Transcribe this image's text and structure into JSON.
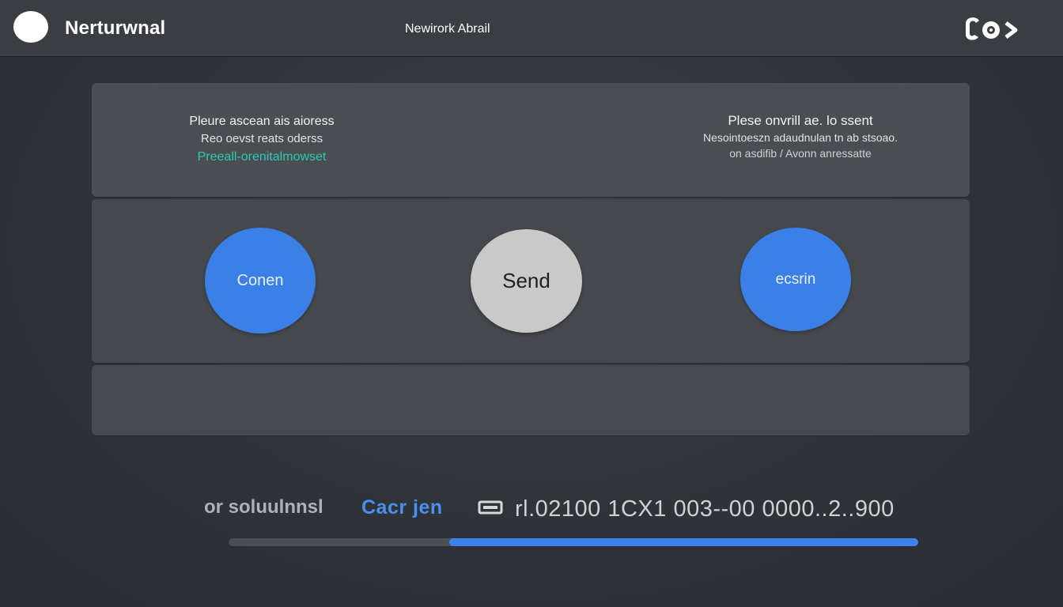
{
  "header": {
    "app_title": "Nerturwnal",
    "window_title": "Newirork Abrail",
    "icons": [
      "app-logo-icon",
      "camera-icon",
      "chevron-right-icon"
    ]
  },
  "messages": {
    "left": {
      "line1": "Pleure ascean ais aioress",
      "line2": "Reo oevst reats oderss",
      "line3": "Preeall-orenitalmowset"
    },
    "right": {
      "line1": "Plese onvrill ae. lo ssent",
      "line2": "Nesointoeszn adaudnulan tn ab stsoao.",
      "line3": "on asdifib / Avonn anressatte"
    }
  },
  "buttons": {
    "connect": "Conen",
    "send": "Send",
    "action": "ecsrin"
  },
  "status": {
    "label": "or soluulnnsl",
    "link": "Cacr jen",
    "value": "rl.02100 1CX1  003--00 0000..2..900"
  },
  "progress": {
    "start_fraction": 0.32,
    "end_fraction": 1.0
  },
  "colors": {
    "accent_blue": "#3b80e6",
    "teal_text": "#2ec9b2",
    "send_button_gray": "#c9c9c9",
    "background": "#2f3338"
  }
}
